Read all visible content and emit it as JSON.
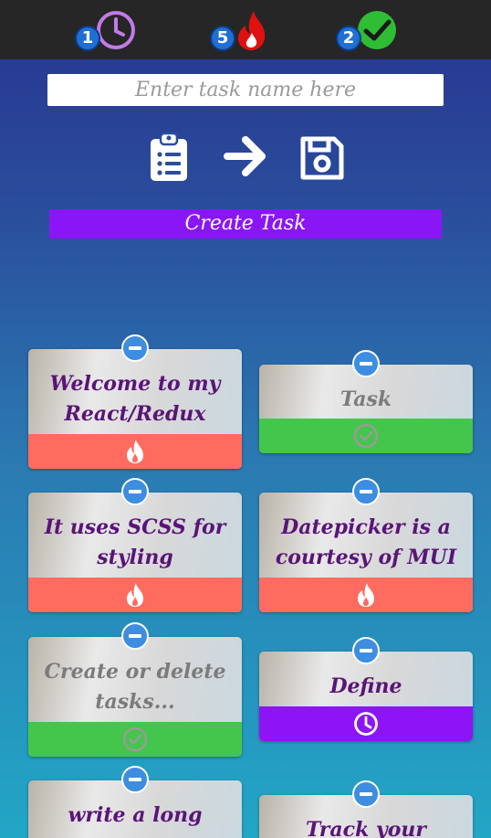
{
  "stats": {
    "pending": {
      "count": "1",
      "icon": "clock-icon",
      "color": "#c27be8"
    },
    "urgent": {
      "count": "5",
      "icon": "fire-icon",
      "color": "#e01010"
    },
    "completed": {
      "count": "2",
      "icon": "checkmark-icon",
      "color": "#2ebd35"
    }
  },
  "form": {
    "task_placeholder": "Enter task name here",
    "create_label": "Create Task"
  },
  "toolbar": {
    "clipboard_icon": "clipboard-list-icon",
    "arrow_icon": "arrow-right-icon",
    "save_icon": "floppy-disk-icon"
  },
  "colors": {
    "urgent": "#ff6b5f",
    "done": "#43c64b",
    "deadline": "#8c14f5",
    "create_button": "#8a16f5"
  },
  "tasks": [
    {
      "text": "Welcome to my React/Redux based",
      "status": "urgent"
    },
    {
      "text": "Task management app",
      "status": "done"
    },
    {
      "text": "It uses SCSS for styling",
      "status": "urgent"
    },
    {
      "text": "Datepicker is a courtesy of MUI",
      "status": "urgent"
    },
    {
      "text": "Create or delete tasks...",
      "status": "done"
    },
    {
      "text": "Define deadlines...",
      "status": "deadline"
    },
    {
      "text": "write a long",
      "status": "none"
    },
    {
      "text": "Track your progress :)",
      "status": "none"
    }
  ]
}
